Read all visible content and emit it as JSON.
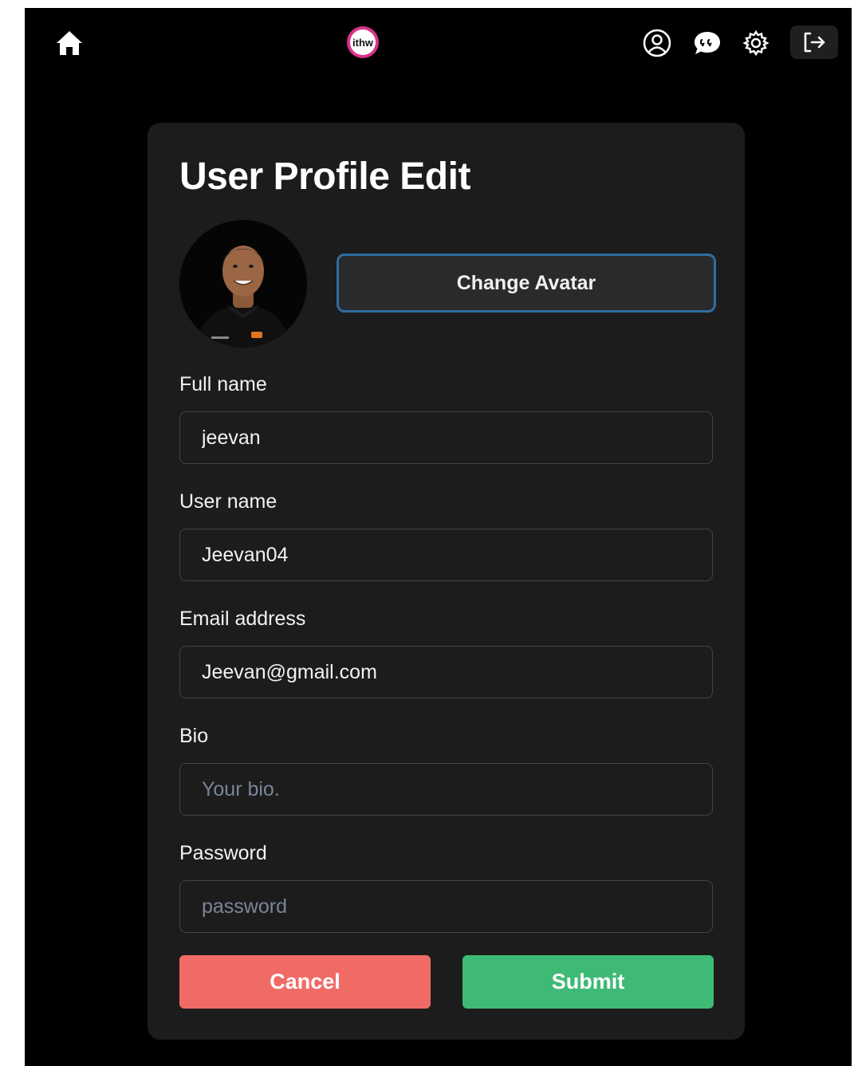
{
  "nav": {
    "icons": [
      "home-icon",
      "app-logo",
      "user-profile-icon",
      "chat-icon",
      "gear-icon",
      "logout-icon"
    ],
    "logo_text": "ithw"
  },
  "form": {
    "title": "User Profile Edit",
    "change_avatar_label": "Change Avatar",
    "fields": {
      "full_name": {
        "label": "Full name",
        "value": "jeevan",
        "placeholder": ""
      },
      "user_name": {
        "label": "User name",
        "value": "Jeevan04",
        "placeholder": ""
      },
      "email": {
        "label": "Email address",
        "value": "Jeevan@gmail.com",
        "placeholder": ""
      },
      "bio": {
        "label": "Bio",
        "value": "",
        "placeholder": "Your bio."
      },
      "password": {
        "label": "Password",
        "value": "",
        "placeholder": "password"
      }
    },
    "cancel_label": "Cancel",
    "submit_label": "Submit"
  },
  "colors": {
    "background": "#000000",
    "card": "#1c1c1c",
    "cancel": "#f06b66",
    "submit": "#3fba76",
    "avatar_border": "#2f6d9f",
    "logo_ring": "#d9338a"
  }
}
